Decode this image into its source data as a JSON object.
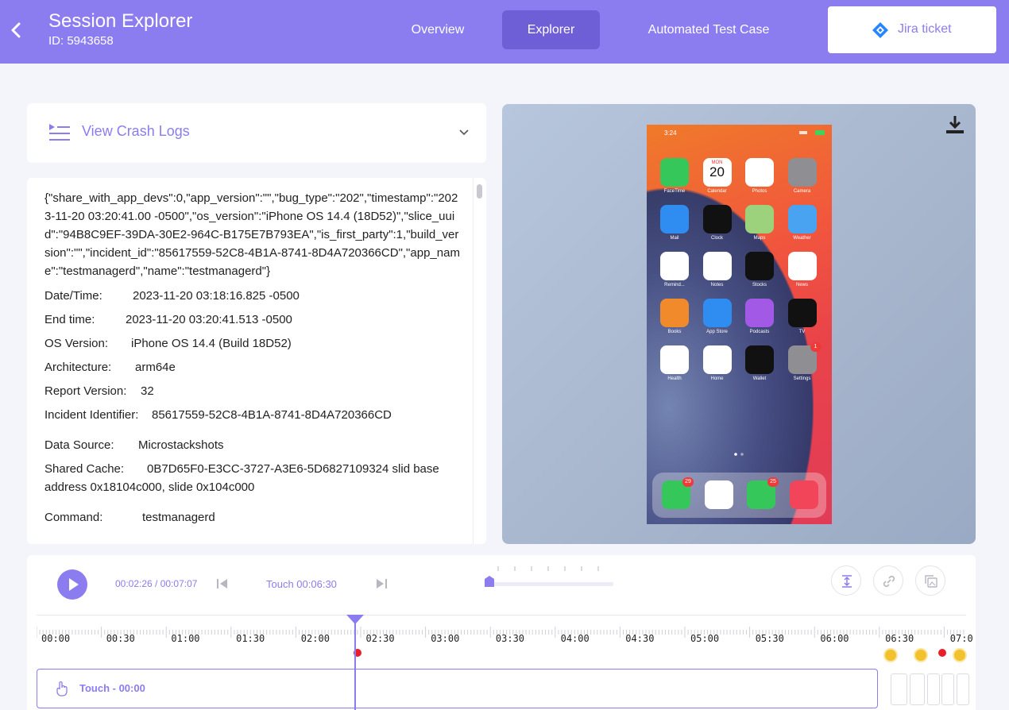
{
  "header": {
    "back_icon": "chevron-left-icon",
    "title": "Session Explorer",
    "subtitle": "ID: 5943658",
    "tabs": [
      {
        "label": "Overview",
        "active": false
      },
      {
        "label": "Explorer",
        "active": true
      },
      {
        "label": "Automated Test Case",
        "active": false
      }
    ],
    "jira_label": "Jira ticket",
    "accent_color": "#8b7cf0",
    "active_tab_color": "#6f5fd6"
  },
  "crash_logs": {
    "label": "View Crash Logs",
    "json_text": "{\"share_with_app_devs\":0,\"app_version\":\"\",\"bug_type\":\"202\",\"timestamp\":\"2023-11-20 03:20:41.00 -0500\",\"os_version\":\"iPhone OS 14.4 (18D52)\",\"slice_uuid\":\"94B8C9EF-39DA-30E2-964C-B175E7B793EA\",\"is_first_party\":1,\"build_version\":\"\",\"incident_id\":\"85617559-52C8-4B1A-8741-8D4A720366CD\",\"app_name\":\"testmanagerd\",\"name\":\"testmanagerd\"}",
    "rows": [
      {
        "key": "Date/Time:",
        "value": "2023-11-20 03:18:16.825 -0500"
      },
      {
        "key": "End time:",
        "value": "2023-11-20 03:20:41.513 -0500"
      },
      {
        "key": "OS Version:",
        "value": "iPhone OS 14.4 (Build 18D52)"
      },
      {
        "key": "Architecture:",
        "value": "arm64e"
      },
      {
        "key": "Report Version:",
        "value": "32"
      },
      {
        "key": "Incident Identifier:",
        "value": "85617559-52C8-4B1A-8741-8D4A720366CD"
      },
      {
        "key": "Data Source:",
        "value": "Microstackshots"
      },
      {
        "key": "Shared Cache:",
        "value": "0B7D65F0-E3CC-3727-A3E6-5D6827109324 slid base address 0x18104c000, slide 0x104c000"
      },
      {
        "key": "Command:",
        "value": "testmanagerd"
      }
    ]
  },
  "device": {
    "status_time": "3:24",
    "apps": [
      {
        "label": "FaceTime",
        "color": "#35c759"
      },
      {
        "label": "Calendar",
        "color": "#ffffff",
        "day": "MON",
        "date": "20"
      },
      {
        "label": "Photos",
        "color": "#ffffff"
      },
      {
        "label": "Camera",
        "color": "#8e8e93"
      },
      {
        "label": "Mail",
        "color": "#2f8cf0"
      },
      {
        "label": "Clock",
        "color": "#111111"
      },
      {
        "label": "Maps",
        "color": "#9bd27b"
      },
      {
        "label": "Weather",
        "color": "#4aa3f0"
      },
      {
        "label": "Remind...",
        "color": "#ffffff"
      },
      {
        "label": "Notes",
        "color": "#ffffff"
      },
      {
        "label": "Stocks",
        "color": "#111111"
      },
      {
        "label": "News",
        "color": "#ffffff"
      },
      {
        "label": "Books",
        "color": "#f08a2a"
      },
      {
        "label": "App Store",
        "color": "#2f8cf0"
      },
      {
        "label": "Podcasts",
        "color": "#a259e6"
      },
      {
        "label": "TV",
        "color": "#111111"
      },
      {
        "label": "Health",
        "color": "#ffffff"
      },
      {
        "label": "Home",
        "color": "#ffffff"
      },
      {
        "label": "Wallet",
        "color": "#111111"
      },
      {
        "label": "Settings",
        "color": "#8e8e93",
        "badge": "1"
      }
    ],
    "dock": [
      {
        "name": "Phone",
        "color": "#35c759",
        "badge": "29"
      },
      {
        "name": "Safari",
        "color": "#ffffff"
      },
      {
        "name": "Messages",
        "color": "#35c759",
        "badge": "25"
      },
      {
        "name": "Music",
        "color": "#f2455a"
      }
    ]
  },
  "player": {
    "time": "00:02:26 / 00:07:07",
    "touch_label": "Touch 00:06:30",
    "ticks": [
      "00:00",
      "00:30",
      "01:00",
      "01:30",
      "02:00",
      "02:30",
      "03:00",
      "03:30",
      "04:00",
      "04:30",
      "05:00",
      "05:30",
      "06:00",
      "06:30",
      "07:0"
    ],
    "track_label": "Touch - 00:00"
  }
}
